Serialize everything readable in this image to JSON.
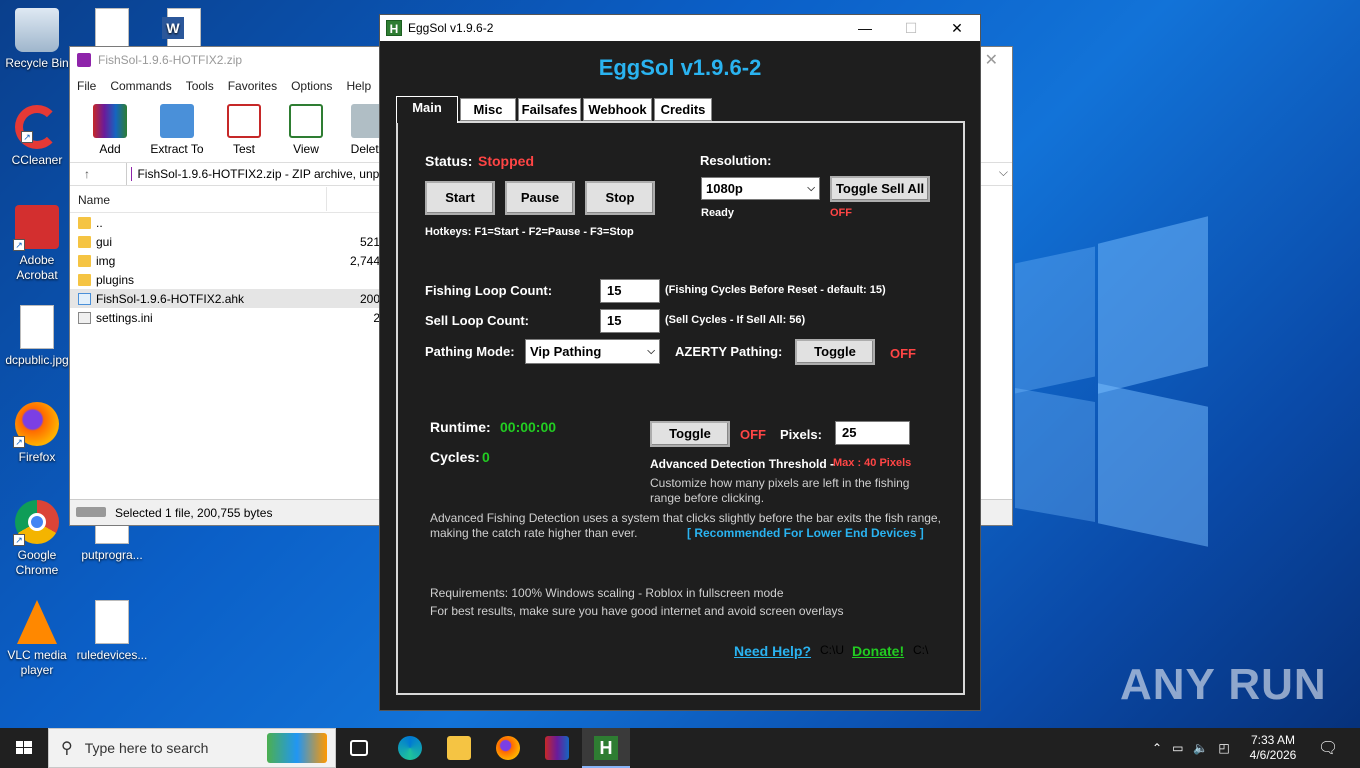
{
  "desktop": {
    "icons": [
      {
        "label": "Recycle Bin"
      },
      {
        "label": "CCleaner"
      },
      {
        "label": "Adobe Acrobat"
      },
      {
        "label": "dcpublic.jpg"
      },
      {
        "label": "Firefox"
      },
      {
        "label": "Google Chrome"
      },
      {
        "label": "VLC media player"
      },
      {
        "label": "putprogra..."
      },
      {
        "label": "ruledevices..."
      }
    ]
  },
  "winrar": {
    "title": "FishSol-1.9.6-HOTFIX2.zip",
    "menu": [
      "File",
      "Commands",
      "Tools",
      "Favorites",
      "Options",
      "Help"
    ],
    "toolbar": [
      "Add",
      "Extract To",
      "Test",
      "View",
      "Delete"
    ],
    "path": "FishSol-1.9.6-HOTFIX2.zip - ZIP archive, unpa",
    "column_name": "Name",
    "files": [
      {
        "name": "..",
        "size": ""
      },
      {
        "name": "gui",
        "size": "521"
      },
      {
        "name": "img",
        "size": "2,744"
      },
      {
        "name": "plugins",
        "size": ""
      },
      {
        "name": "FishSol-1.9.6-HOTFIX2.ahk",
        "size": "200"
      },
      {
        "name": "settings.ini",
        "size": "2"
      }
    ],
    "status": "Selected 1 file, 200,755 bytes"
  },
  "eggsol": {
    "window_title": "EggSol v1.9.6-2",
    "heading": "EggSol v1.9.6-2",
    "tabs": [
      "Main",
      "Misc",
      "Failsafes",
      "Webhook",
      "Credits"
    ],
    "status_label": "Status:",
    "status_value": "Stopped",
    "start": "Start",
    "pause": "Pause",
    "stop": "Stop",
    "hotkeys": "Hotkeys: F1=Start - F2=Pause - F3=Stop",
    "resolution_label": "Resolution:",
    "resolution_value": "1080p",
    "ready": "Ready",
    "toggle_sell_all": "Toggle Sell All",
    "sell_all_state": "OFF",
    "fishing_loop_label": "Fishing Loop Count:",
    "fishing_loop_value": "15",
    "fishing_loop_hint": "(Fishing Cycles Before Reset - default: 15)",
    "sell_loop_label": "Sell Loop Count:",
    "sell_loop_value": "15",
    "sell_loop_hint": "(Sell Cycles  -  If Sell All: 56)",
    "pathing_label": "Pathing Mode:",
    "pathing_value": "Vip Pathing",
    "azerty_label": "AZERTY Pathing:",
    "azerty_toggle": "Toggle",
    "azerty_state": "OFF",
    "runtime_label": "Runtime:",
    "runtime_value": "00:00:00",
    "cycles_label": "Cycles:",
    "cycles_value": "0",
    "adv_toggle": "Toggle",
    "adv_state": "OFF",
    "pixels_label": "Pixels:",
    "pixels_value": "25",
    "threshold_label": "Advanced Detection Threshold -",
    "threshold_max": "Max : 40 Pixels",
    "threshold_desc1": "Customize how many pixels are left in the fishing",
    "threshold_desc2": "range before clicking.",
    "adv_desc1": "Advanced Fishing Detection uses a system that clicks slightly before the bar exits the fish range,",
    "adv_desc2": "making the catch rate higher than ever.",
    "recommended": "[ Recommended For Lower End Devices ]",
    "req1": "Requirements: 100% Windows scaling - Roblox in fullscreen mode",
    "req2": "For best results, make sure you have good internet and avoid screen overlays",
    "need_help": "Need Help?",
    "donate": "Donate!",
    "junk1": "C:\\U",
    "junk2": "C:\\"
  },
  "taskbar": {
    "search_placeholder": "Type here to search",
    "time": "7:33 AM",
    "date": "4/6/2026"
  },
  "watermark": "ANY RUN"
}
